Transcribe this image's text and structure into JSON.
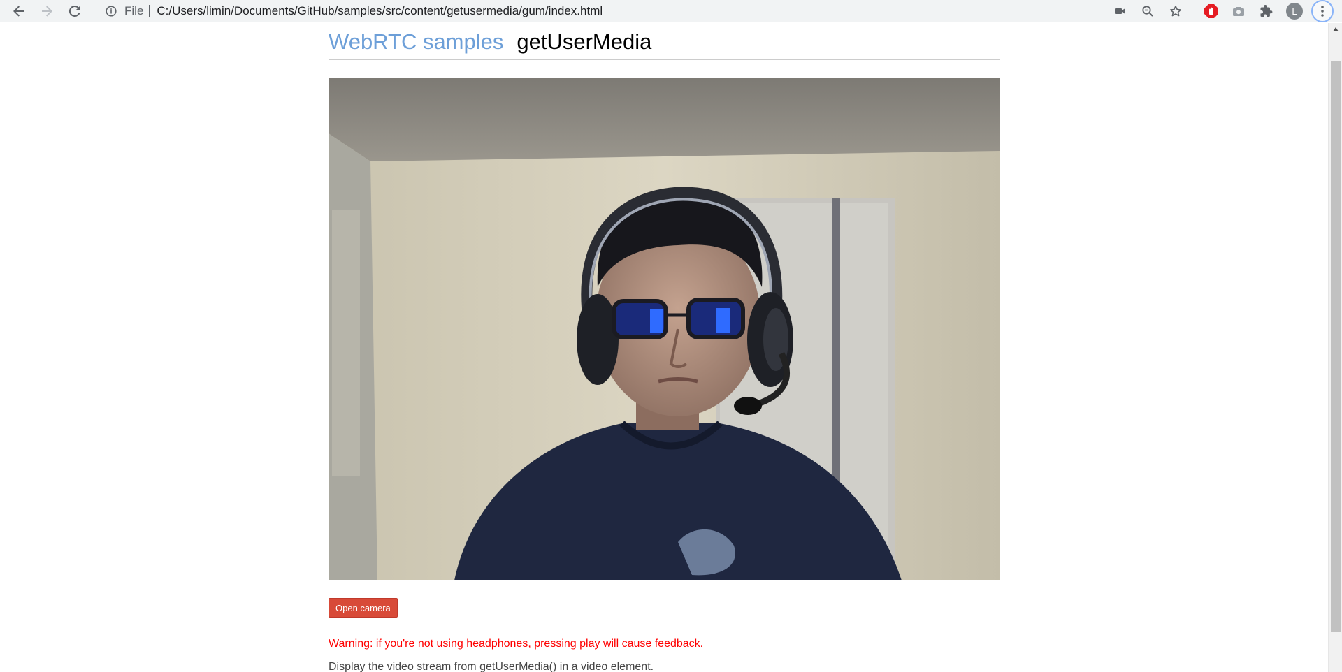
{
  "browser": {
    "address_bar": {
      "scheme_label": "File",
      "url": "C:/Users/limin/Documents/GitHub/samples/src/content/getusermedia/gum/index.html"
    },
    "profile_initial": "L",
    "icons": [
      "back-icon",
      "forward-icon",
      "reload-icon",
      "info-icon",
      "camera-in-use-icon",
      "zoom-icon",
      "bookmark-star-icon",
      "adblock-icon",
      "screenshot-camera-icon",
      "extensions-puzzle-icon",
      "menu-dots-icon"
    ]
  },
  "page": {
    "site_link": "WebRTC samples",
    "title": "getUserMedia",
    "open_camera_button": "Open camera",
    "warning": "Warning: if you're not using headphones, pressing play will cause feedback.",
    "description": "Display the video stream from getUserMedia() in a video element."
  },
  "colors": {
    "site_link": "#6d9fd8",
    "button_bg": "#d84a38",
    "warning": "#ff0000"
  }
}
